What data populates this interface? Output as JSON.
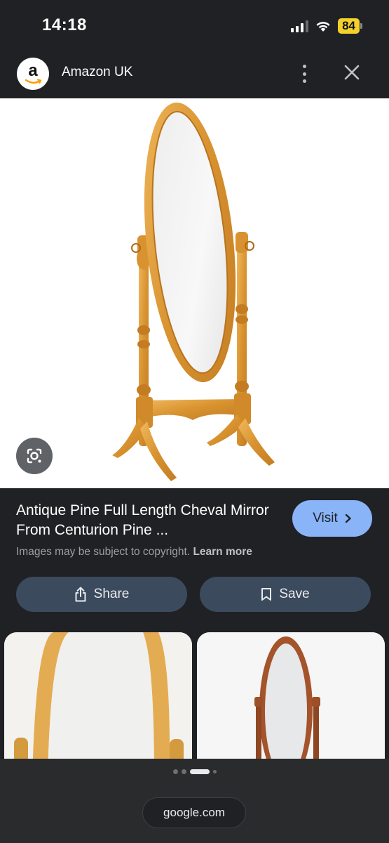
{
  "status_bar": {
    "time": "14:18",
    "battery": "84"
  },
  "header": {
    "logo_letter": "a",
    "source_name": "Amazon UK"
  },
  "result": {
    "title": "Antique Pine Full Length Cheval Mirror From Centurion Pine ...",
    "visit_label": "Visit",
    "copyright_text": "Images may be subject to copyright.",
    "learn_more_label": "Learn more"
  },
  "actions": {
    "share_label": "Share",
    "save_label": "Save"
  },
  "footer": {
    "url": "google.com"
  },
  "icons": {
    "lens": "google-lens-icon",
    "share": "share-icon",
    "save": "bookmark-icon",
    "more": "more-vert-icon",
    "close": "close-icon",
    "visit_arrow": "chevron-right-icon"
  },
  "colors": {
    "background": "#202124",
    "visit_button": "#8ab4f8",
    "action_button": "#3c4a5e",
    "battery": "#f2d12e"
  }
}
